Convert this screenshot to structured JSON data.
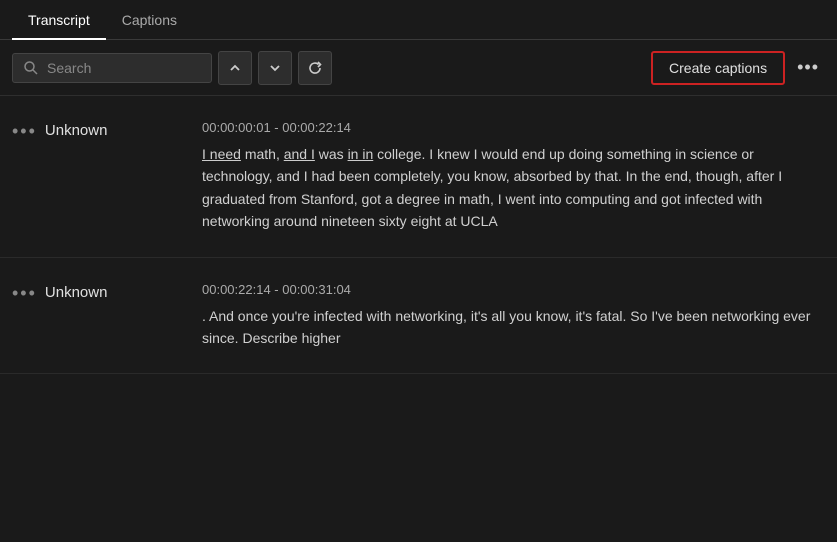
{
  "tabs": [
    {
      "label": "Transcript",
      "active": true
    },
    {
      "label": "Captions",
      "active": false
    }
  ],
  "toolbar": {
    "search_placeholder": "Search",
    "up_arrow": "▲",
    "down_arrow": "▼",
    "refresh_icon": "↻",
    "create_captions_label": "Create captions",
    "more_label": "•••"
  },
  "transcript_entries": [
    {
      "dots": "•••",
      "speaker": "Unknown",
      "timestamp": "00:00:00:01 - 00:00:22:14",
      "text_parts": [
        {
          "text": "I need",
          "underline": true
        },
        {
          "text": " math, ",
          "underline": false
        },
        {
          "text": "and I",
          "underline": true
        },
        {
          "text": " was ",
          "underline": false
        },
        {
          "text": "in in",
          "underline": true
        },
        {
          "text": " college. I knew I would end up doing something in science or technology, and I had been completely, you know, absorbed by that. In the end, though, after I graduated from Stanford, got a degree in math, I went into computing and got infected with networking around nineteen sixty eight at UCLA",
          "underline": false
        }
      ]
    },
    {
      "dots": "•••",
      "speaker": "Unknown",
      "timestamp": "00:00:22:14 - 00:00:31:04",
      "text_parts": [
        {
          "text": ". And once you're infected with networking, it's all you know, it's fatal. So I've been networking ever since. Describe higher",
          "underline": false
        }
      ]
    }
  ]
}
